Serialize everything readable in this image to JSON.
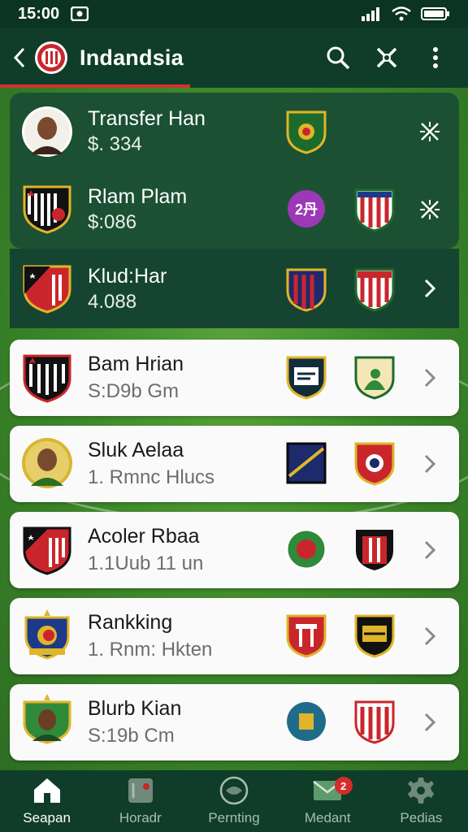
{
  "status_bar": {
    "time": "15:00"
  },
  "app_bar": {
    "title": "Indandsia"
  },
  "rows": [
    {
      "name": "Transfer Han",
      "sub": "$. 334",
      "trail": "expand-icon"
    },
    {
      "name": "Rlam Plam",
      "sub": "$:086",
      "badge_text": "2丹",
      "trail": "expand-icon"
    },
    {
      "name": "Klud:Har",
      "sub": "4.088",
      "trail": "chevron-right-icon"
    },
    {
      "name": "Bam Hrian",
      "sub": "S:D9b  Gm",
      "trail": "chevron-right-icon"
    },
    {
      "name": "Sluk Aelaa",
      "sub": "1. Rmnc Hlucs",
      "trail": "chevron-right-icon"
    },
    {
      "name": "Acoler Rbaa",
      "sub": "1.1Uub  11 un",
      "trail": "chevron-right-icon"
    },
    {
      "name": "Rankking",
      "sub": "1. Rnm: Hkten",
      "trail": "chevron-right-icon"
    },
    {
      "name": "Blurb Kian",
      "sub": "S:19b  Cm",
      "trail": "chevron-right-icon"
    }
  ],
  "nav": [
    {
      "label": "Seapan",
      "icon": "home-icon",
      "active": true
    },
    {
      "label": "Horadr",
      "icon": "lineup-icon",
      "active": false
    },
    {
      "label": "Pernting",
      "icon": "ball-icon",
      "active": false
    },
    {
      "label": "Medant",
      "icon": "mail-icon",
      "active": false,
      "badge": "2"
    },
    {
      "label": "Pedias",
      "icon": "gear-icon",
      "active": false
    }
  ],
  "colors": {
    "primary": "#0f3d2a",
    "accent": "#d2332e",
    "card_dark": "#1b4e34"
  }
}
